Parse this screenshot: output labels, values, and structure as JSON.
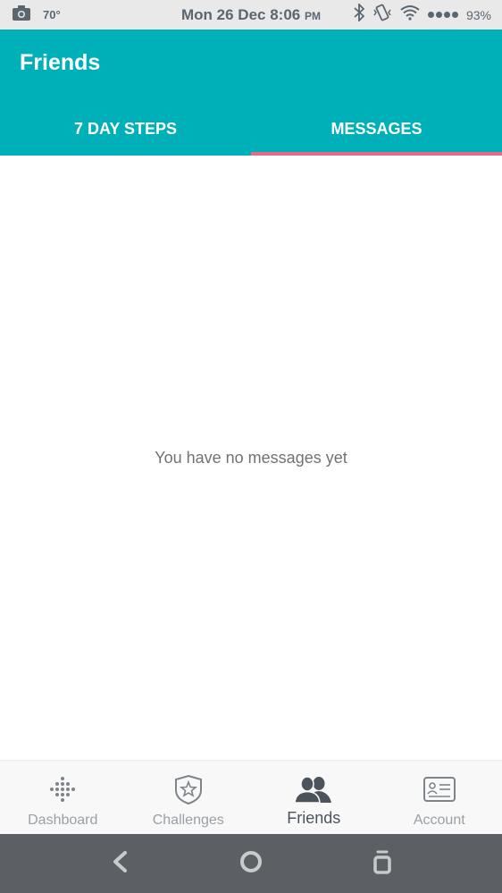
{
  "status_bar": {
    "temperature": "70°",
    "clock": "Mon 26 Dec 8:06",
    "ampm": "PM",
    "battery": "93%"
  },
  "header": {
    "title": "Friends",
    "tabs": [
      {
        "label": "7 DAY STEPS",
        "active": false
      },
      {
        "label": "MESSAGES",
        "active": true
      }
    ]
  },
  "main": {
    "empty_message": "You have no messages yet"
  },
  "bottom_nav": {
    "items": [
      {
        "label": "Dashboard",
        "icon": "dashboard-icon",
        "active": false
      },
      {
        "label": "Challenges",
        "icon": "challenges-star-icon",
        "active": false
      },
      {
        "label": "Friends",
        "icon": "friends-icon",
        "active": true
      },
      {
        "label": "Account",
        "icon": "account-card-icon",
        "active": false
      }
    ]
  },
  "colors": {
    "header": "#00b0b9",
    "tab_indicator": "#e86a88",
    "system_nav": "#5c5f63"
  }
}
